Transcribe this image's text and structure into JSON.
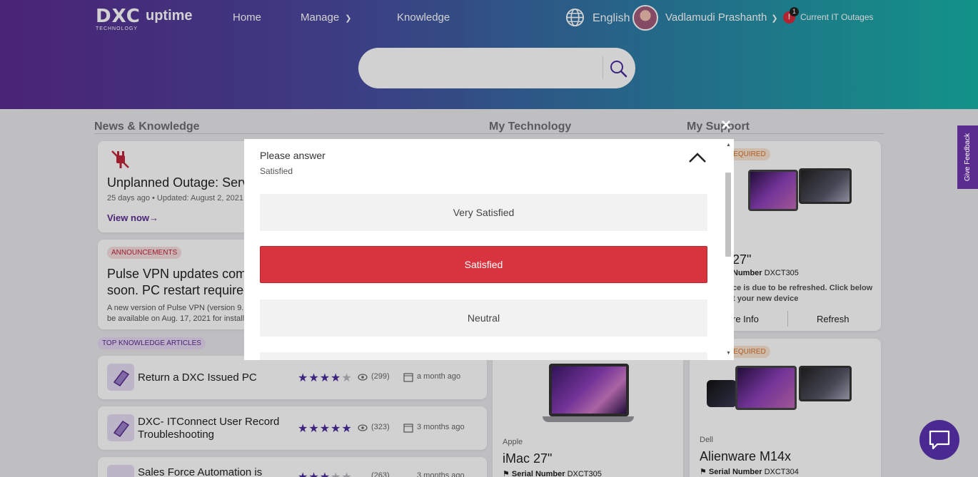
{
  "header": {
    "logo_text": "DXC",
    "logo_sub": "TECHNOLOGY",
    "app_name": "uptime",
    "nav": [
      {
        "label": "Home"
      },
      {
        "label": "Manage"
      },
      {
        "label": "Knowledge"
      }
    ],
    "language": "English",
    "user_name": "Vadlamudi Prashanth",
    "alert_count": "1",
    "alert_symbol": "!",
    "outages_label": "Current IT Outages"
  },
  "search": {
    "placeholder": ""
  },
  "sections": {
    "news": "News & Knowledge",
    "technology": "My Technology",
    "support": "My Support"
  },
  "news": {
    "outage_title": "Unplanned Outage: Serv",
    "outage_meta": "25 days ago • Updated: August 2, 2021 a",
    "outage_link": "View now→",
    "announcement_badge": "ANNOUNCEMENTS",
    "announcement_title_1": "Pulse VPN updates com",
    "announcement_title_2": "soon. PC restart required",
    "announcement_body_1": "A new version of Pulse VPN (version 9.1",
    "announcement_body_2": "be available on Aug. 17, 2021 for install t",
    "top_badge": "TOP KNOWLEDGE ARTICLES",
    "articles": [
      {
        "title": "Return a DXC Issued PC",
        "title2": "",
        "rating": 4,
        "views": "(299)",
        "when": "a month ago"
      },
      {
        "title": "DXC- ITConnect User Record",
        "title2": "Troubleshooting",
        "rating": 5,
        "views": "(323)",
        "when": "3 months ago"
      },
      {
        "title": "Sales Force Automation is",
        "title2": "",
        "rating": 3,
        "views": "(263)",
        "when": "3 months ago"
      }
    ]
  },
  "technology": {
    "brand": "Apple",
    "model": "iMac 27\"",
    "serial_label": "Serial Number",
    "serial": "DXCT305"
  },
  "support": {
    "card1_badge": "REQUIRED",
    "card1_model": "27\"",
    "card1_serial_label": "Number",
    "card1_serial": "DXCT305",
    "card1_msg1": "ce is due to be refreshed. Click below",
    "card1_msg2": "t your new device",
    "card1_more": "re Info",
    "card1_refresh": "Refresh",
    "card2_badge": "REQUIRED",
    "card2_brand": "Dell",
    "card2_model": "Alienware M14x",
    "card2_serial_label": "Serial Number",
    "card2_serial": "DXCT304"
  },
  "modal": {
    "question": "Please answer",
    "selected": "Satisfied",
    "options": [
      {
        "label": "Very Satisfied",
        "active": false
      },
      {
        "label": "Satisfied",
        "active": true
      },
      {
        "label": "Neutral",
        "active": false
      }
    ],
    "close_symbol": "×"
  },
  "feedback_tab": "Give Feedback",
  "colors": {
    "accent": "#5b2c8f",
    "selected": "#d8343f",
    "outage": "#c0253a"
  }
}
